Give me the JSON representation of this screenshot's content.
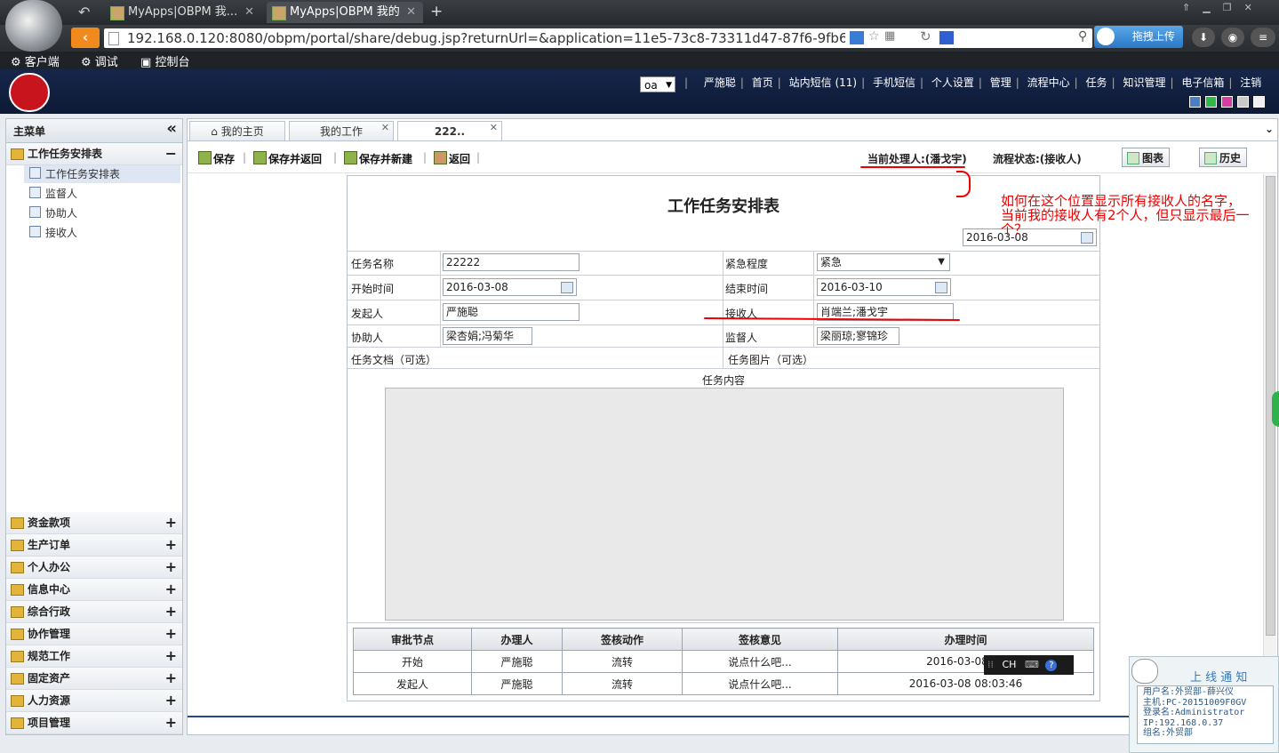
{
  "browser": {
    "tabs": [
      {
        "title": "MyApps|OBPM 我..."
      },
      {
        "title": "MyApps|OBPM 我的"
      }
    ],
    "new_tab": "+",
    "url": "192.168.0.120:8080/obpm/portal/share/debug.jsp?returnUrl=&application=11e5-73c8-73311d47-87f6-9fb671e",
    "upload_label": "拖拽上传",
    "bookmarks": [
      "客户端",
      "调试",
      "控制台"
    ]
  },
  "header": {
    "org_select": "oa",
    "nav": [
      "严施聪",
      "首页",
      "站内短信 (11)",
      "手机短信",
      "个人设置",
      "管理",
      "流程中心",
      "任务",
      "知识管理",
      "电子信箱",
      "注销"
    ],
    "skins": [
      "#4a7fc8",
      "#2fb84a",
      "#d63ca5",
      "#c9c9c9",
      "#f0f0f0"
    ]
  },
  "sidebar": {
    "title": "主菜单",
    "collapse": "«",
    "open_group": {
      "label": "工作任务安排表",
      "toggle": "−"
    },
    "items": [
      "工作任务安排表",
      "监督人",
      "协助人",
      "接收人"
    ],
    "groups": [
      "资金款项",
      "生产订单",
      "个人办公",
      "信息中心",
      "综合行政",
      "协作管理",
      "规范工作",
      "固定资产",
      "人力资源",
      "项目管理"
    ]
  },
  "page_tabs": [
    {
      "label": "我的主页"
    },
    {
      "label": "我的工作"
    },
    {
      "label": "222.."
    }
  ],
  "toolbar": {
    "save": "保存",
    "save_back": "保存并返回",
    "save_new": "保存并新建",
    "back": "返回",
    "current_handler": "当前处理人:(潘戈宇)",
    "flow_status": "流程状态:(接收人)",
    "chart": "图表",
    "history": "历史"
  },
  "form": {
    "title": "工作任务安排表",
    "date": "2016-03-08",
    "task_name_label": "任务名称",
    "task_name": "22222",
    "urgency_label": "紧急程度",
    "urgency": "紧急",
    "start_label": "开始时间",
    "start": "2016-03-08",
    "end_label": "结束时间",
    "end": "2016-03-10",
    "initiator_label": "发起人",
    "initiator": "严施聪",
    "receiver_label": "接收人",
    "receiver": "肖端兰;潘戈宇",
    "assistant_label": "协助人",
    "assistant": "梁杏娟;冯菊华",
    "supervisor_label": "监督人",
    "supervisor": "梁丽琼;寥锦珍",
    "doc_label": "任务文档（可选）",
    "image_label": "任务图片（可选）",
    "content_label": "任务内容"
  },
  "approval": {
    "headers": [
      "审批节点",
      "办理人",
      "签核动作",
      "签核意见",
      "办理时间"
    ],
    "rows": [
      [
        "开始",
        "严施聪",
        "流转",
        "说点什么吧...",
        "2016-03-08 08"
      ],
      [
        "发起人",
        "严施聪",
        "流转",
        "说点什么吧...",
        "2016-03-08 08:03:46"
      ]
    ]
  },
  "annotation": "如何在这个位置显示所有接收人的名字，当前我的接收人有2个人，但只显示最后一个？",
  "ime": {
    "label": "CH"
  },
  "notice": {
    "title": "上 线 通 知",
    "user": "用户名:外贸部-薛兴仪",
    "host": "主机:PC-20151009F0GV",
    "login": "登录名:Administrator",
    "ip": "IP:192.168.0.37",
    "group": "组名:外贸部"
  }
}
